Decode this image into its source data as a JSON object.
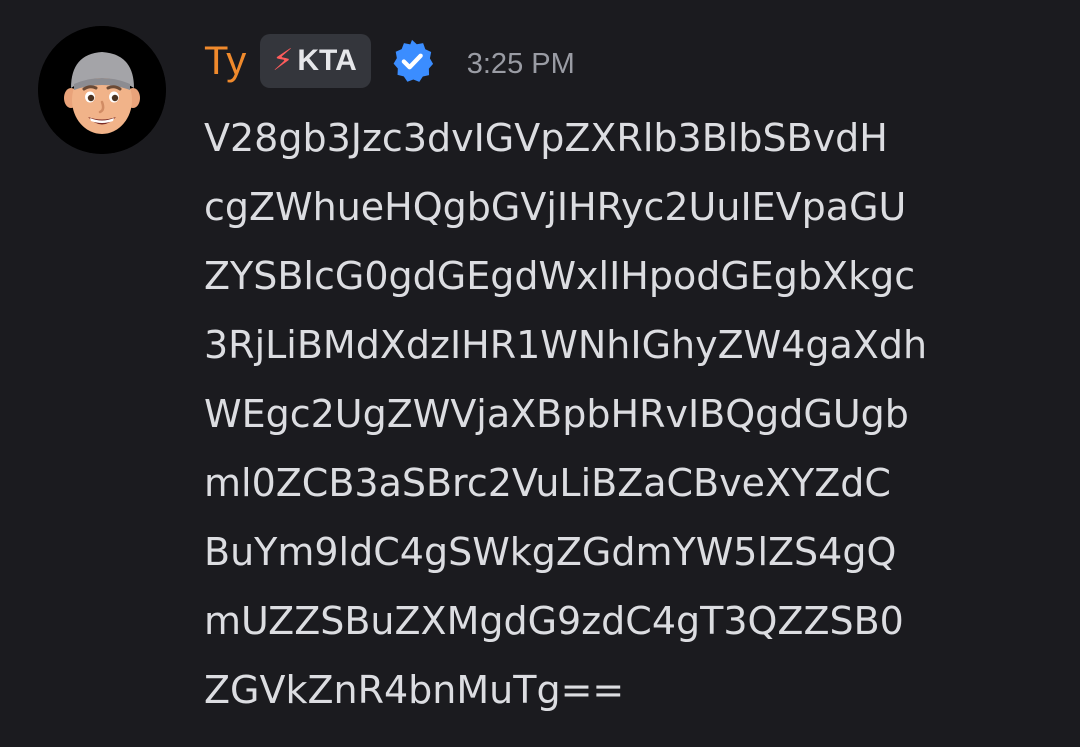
{
  "message": {
    "author": "Ty",
    "tag": {
      "icon": "lightning-bolt-icon",
      "glyph": "⚡",
      "label": "KTA"
    },
    "verified_icon": "verified-badge-icon",
    "timestamp": "3:25 PM",
    "avatar_icon": "memoji-avatar-icon",
    "content_lines": [
      "V28gb3Jzc3dvIGVpZXRlb3BlbSBvdH",
      "cgZWhueHQgbGVjIHRyc2UuIEVpaGU",
      "ZYSBlcG0gdGEgdWxlIHpodGEgbXkgc",
      "3RjLiBMdXdzIHR1WNhIGhyZW4gaXdh",
      "WEgc2UgZWVjaXBpbHRvIBQgdGUgb",
      "ml0ZCB3aSBrc2VuLiBZaCBveXYZdC",
      "BuYm9ldC4gSWkgZGdmYW5lZS4gQ",
      "mUZZSBuZXMgdG9zdC4gT3QZZSB0",
      "ZGVkZnR4bnMuTg=="
    ]
  },
  "colors": {
    "background": "#1b1b1f",
    "username": "#f08a2c",
    "tag_background": "#34363c",
    "verified": "#3b8dff",
    "timestamp": "#9a9ca4",
    "text": "#dcdde1"
  }
}
